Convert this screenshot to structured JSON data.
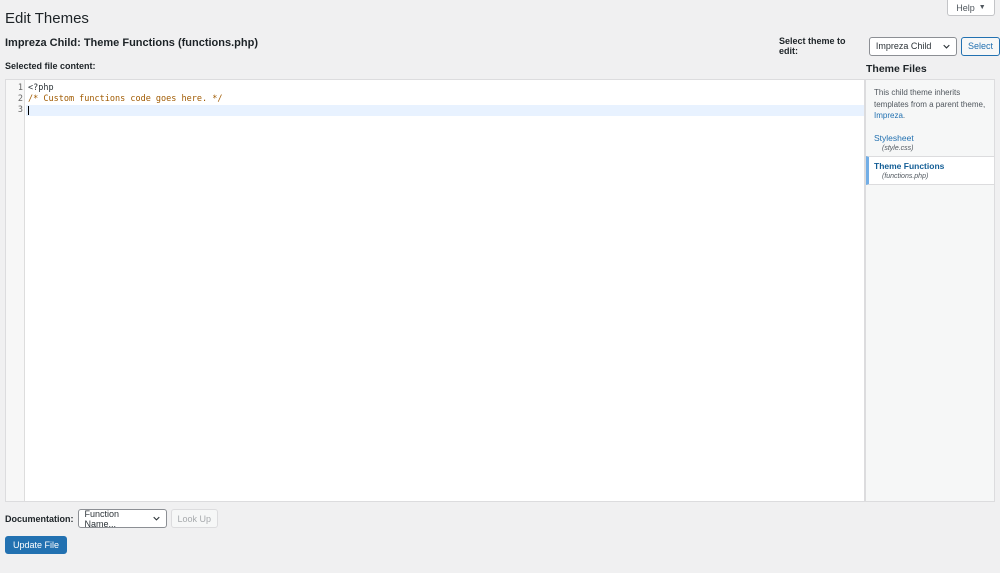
{
  "help": {
    "label": "Help"
  },
  "page": {
    "title": "Edit Themes",
    "file_title": "Impreza Child: Theme Functions (functions.php)",
    "selected_label": "Selected file content:"
  },
  "theme_select": {
    "label": "Select theme to edit:",
    "value": "Impreza Child",
    "button": "Select"
  },
  "editor": {
    "lines": [
      {
        "num": "1",
        "text": "<?php"
      },
      {
        "num": "2",
        "text": "/* Custom functions code goes here. */"
      },
      {
        "num": "3",
        "text": ""
      }
    ]
  },
  "sidebar": {
    "title": "Theme Files",
    "desc_prefix": "This child theme inherits templates from a parent theme, ",
    "desc_link": "Impreza",
    "desc_suffix": ".",
    "files": [
      {
        "name": "Stylesheet",
        "file": "(style.css)"
      },
      {
        "name": "Theme Functions",
        "file": "(functions.php)"
      }
    ]
  },
  "documentation": {
    "label": "Documentation:",
    "select_value": "Function Name...",
    "lookup_button": "Look Up"
  },
  "update_button": "Update File",
  "colors": {
    "accent": "#2271b1",
    "background": "#f0f0f1",
    "comment": "#a05a00"
  }
}
